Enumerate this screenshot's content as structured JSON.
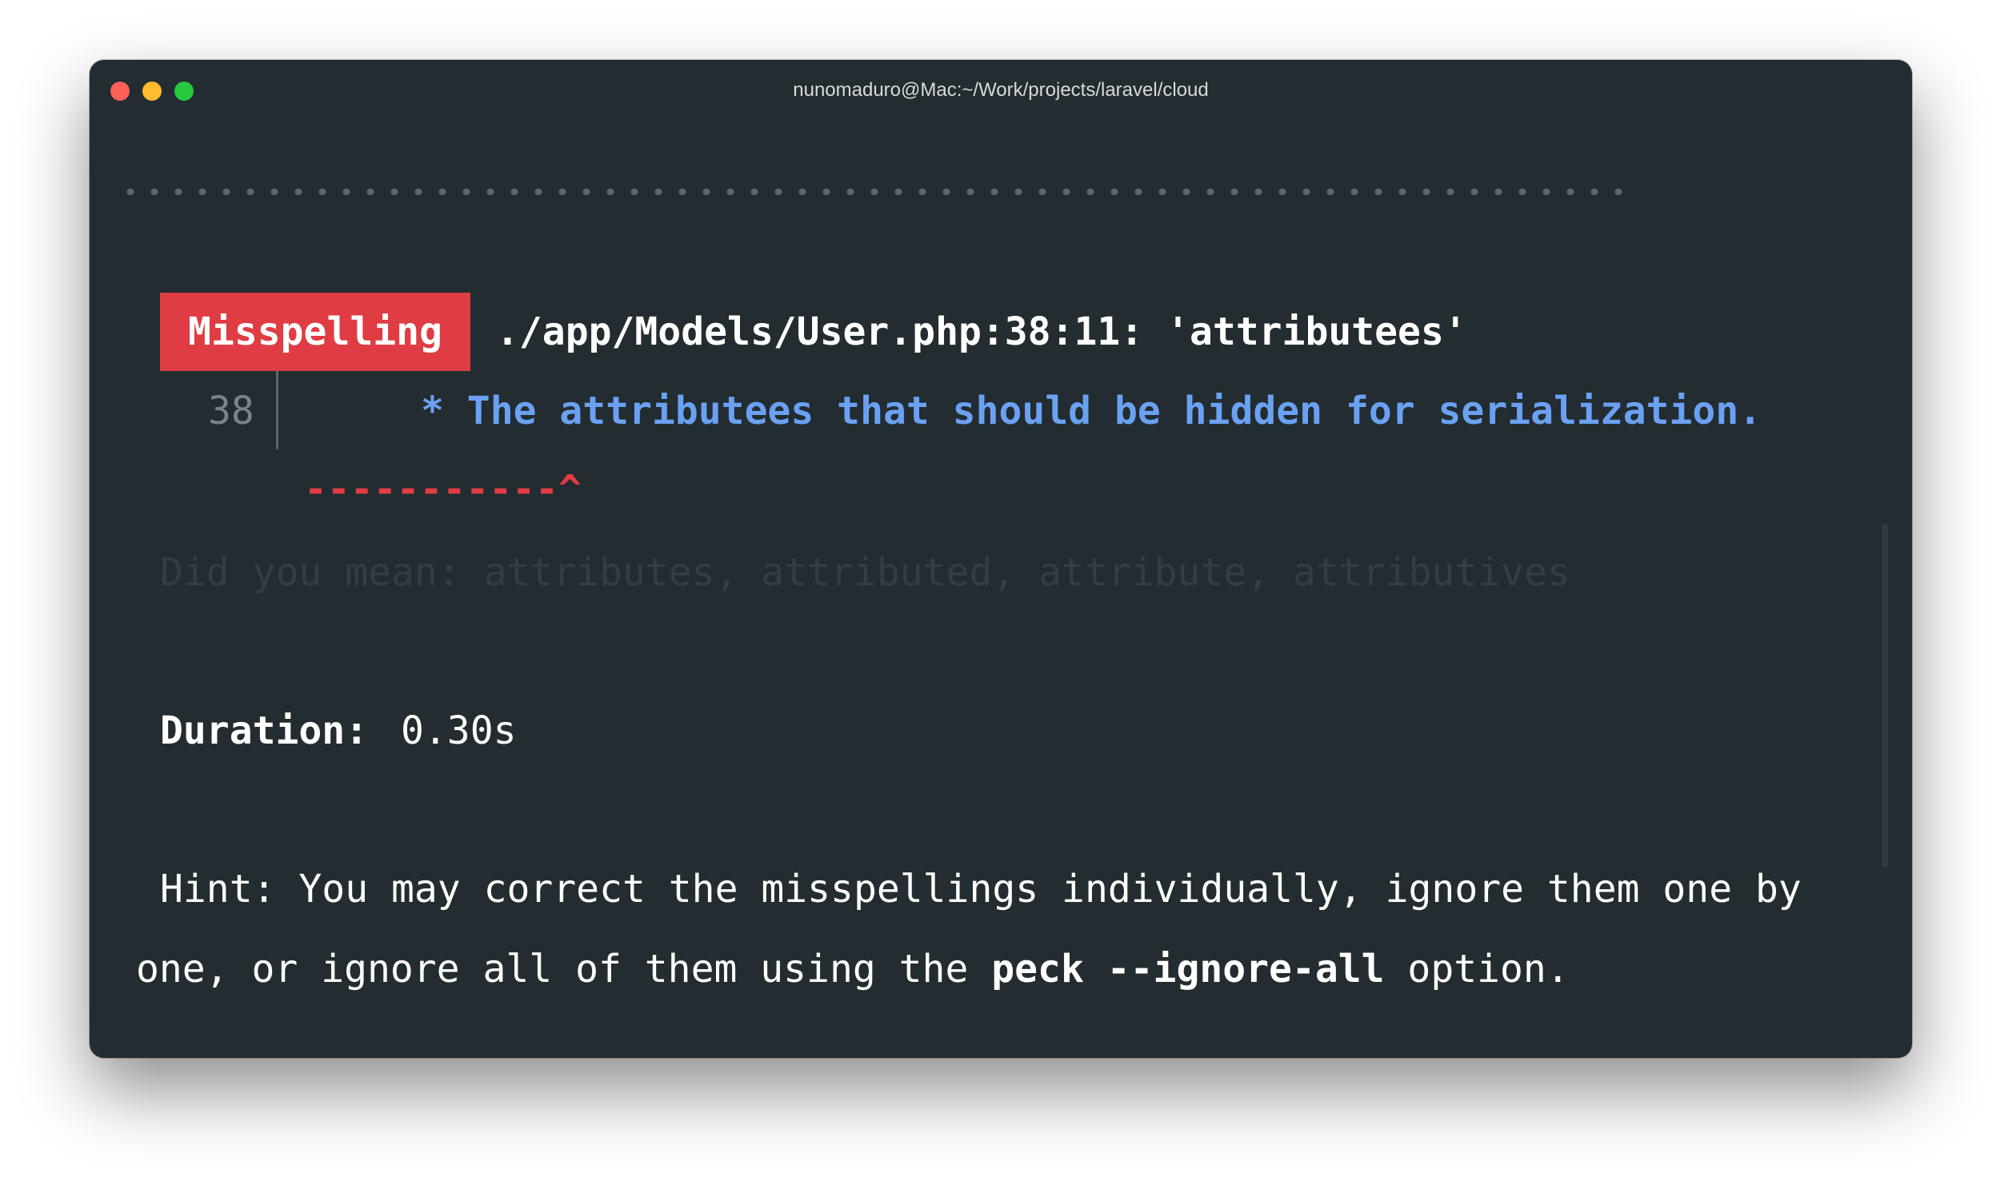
{
  "window": {
    "title": "nunomaduro@Mac:~/Work/projects/laravel/cloud"
  },
  "error": {
    "badge": "Misspelling",
    "location": "./app/Models/User.php:38:11: 'attributees'",
    "line_number": "38",
    "code_line": "* The attributees that should be hidden for serialization.",
    "underline": "-----------^",
    "suggestion": "Did you mean: attributes, attributed, attribute, attributives"
  },
  "summary": {
    "duration_label": "Duration:",
    "duration_value": "0.30s"
  },
  "hint": {
    "line1": "Hint: You may correct the misspellings individually, ignore them one by",
    "line2_prefix": "one, or ignore all of them using the ",
    "command": "peck --ignore-all",
    "line2_suffix": " option."
  },
  "colors": {
    "background": "#232c31",
    "badge": "#e03c44",
    "code": "#6aa1f2",
    "underline": "#e03c44",
    "suggestion": "#333d43"
  }
}
